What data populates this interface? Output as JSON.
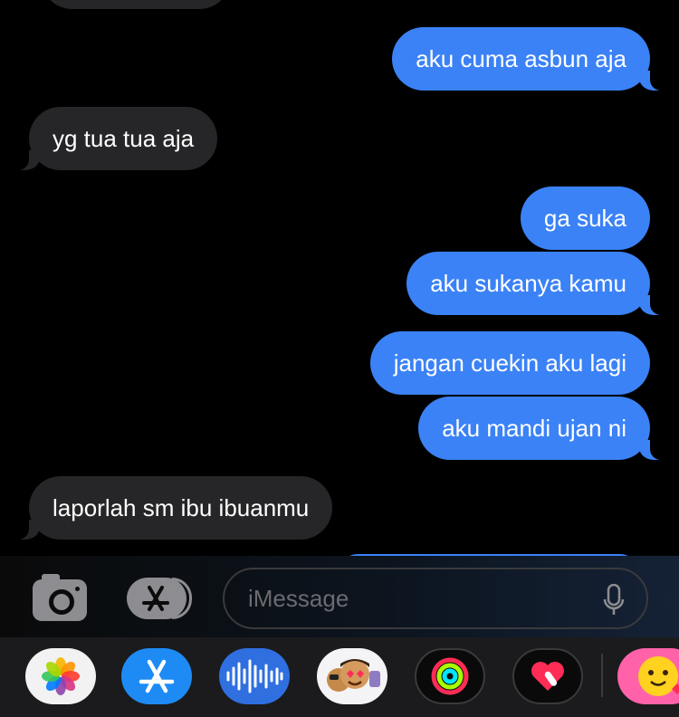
{
  "messages": [
    {
      "side": "sent",
      "text": "aku cuma asbun aja"
    },
    {
      "side": "received",
      "text": "yg tua tua aja"
    },
    {
      "side": "sent",
      "text": "ga suka"
    },
    {
      "side": "sent",
      "text": "aku sukanya kamu"
    },
    {
      "side": "sent",
      "text": "jangan cuekin aku lagi"
    },
    {
      "side": "sent",
      "text": "aku mandi ujan ni"
    },
    {
      "side": "received",
      "text": "laporlah sm ibu ibuanmu"
    }
  ],
  "composer": {
    "placeholder": "iMessage",
    "camera_icon": "camera-icon",
    "apps_icon": "app-store-icon",
    "mic_icon": "microphone-icon"
  },
  "app_tray": [
    {
      "name": "photos-icon"
    },
    {
      "name": "app-store-icon"
    },
    {
      "name": "audio-message-icon"
    },
    {
      "name": "memoji-icon"
    },
    {
      "name": "activity-icon"
    },
    {
      "name": "digital-touch-icon"
    },
    {
      "name": "sticker-icon"
    }
  ],
  "colors": {
    "sent_bubble": "#3b82f6",
    "received_bubble": "#262628",
    "background": "#000000"
  }
}
